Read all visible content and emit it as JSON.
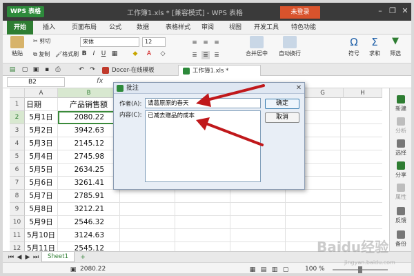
{
  "app": {
    "logo_text": "WPS 表格",
    "doc_title": "工作簿1.xls * [兼容模式] - WPS 表格",
    "login_label": "未登录",
    "window_controls": [
      "min-icon",
      "restore-icon",
      "close-icon"
    ]
  },
  "menu": {
    "tabs": [
      "开始",
      "插入",
      "页面布局",
      "公式",
      "数据",
      "表格样式",
      "审阅",
      "视图",
      "开发工具",
      "特色功能"
    ],
    "active": "开始"
  },
  "ribbon": {
    "paste": "粘贴",
    "cut": "剪切",
    "copy": "复制",
    "format_painter": "格式刷",
    "font_name": "宋体",
    "font_size": "12",
    "merge_center": "合并居中",
    "auto_wrap": "自动换行",
    "symbol": "符号",
    "sum": "求和",
    "filter": "筛选"
  },
  "doc_tabs": [
    {
      "label": "Docer-在线模板",
      "active": false
    },
    {
      "label": "工作簿1.xls *",
      "active": true
    }
  ],
  "formula_bar": {
    "name_box": "B2",
    "fx_label": "fx"
  },
  "sheet": {
    "columns": [
      "A",
      "B",
      "E",
      "F",
      "G",
      "H"
    ],
    "rows": [
      "1",
      "2",
      "3",
      "4",
      "5",
      "6",
      "7",
      "8",
      "9",
      "10",
      "11",
      "12"
    ],
    "header_row": {
      "a": "日期",
      "b": "产品销售额"
    },
    "data": [
      {
        "date": "5月1日",
        "value": "2080.22"
      },
      {
        "date": "5月2日",
        "value": "3942.63"
      },
      {
        "date": "5月3日",
        "value": "2145.12"
      },
      {
        "date": "5月4日",
        "value": "2745.98"
      },
      {
        "date": "5月5日",
        "value": "2634.25"
      },
      {
        "date": "5月6日",
        "value": "3261.41"
      },
      {
        "date": "5月7日",
        "value": "2785.91"
      },
      {
        "date": "5月8日",
        "value": "3212.21"
      },
      {
        "date": "5月9日",
        "value": "2546.32"
      },
      {
        "date": "5月10日",
        "value": "3124.63"
      },
      {
        "date": "5月11日",
        "value": "2545.12"
      }
    ],
    "selected_cell": "B2"
  },
  "sidebar": {
    "items": [
      "新建",
      "分析",
      "选择",
      "分享",
      "属性",
      "反馈",
      "备份"
    ]
  },
  "sheet_tab": "Sheet1",
  "status": {
    "value": "2080.22",
    "zoom": "100 %",
    "zoom_level": 0.5
  },
  "dialog": {
    "title": "批注",
    "author_label": "作者(A):",
    "author_value": "请葛原原的春天",
    "content_label": "内容(C):",
    "content_value": "已减去赠品的成本",
    "ok_label": "确定",
    "cancel_label": "取消"
  },
  "watermark": {
    "text": "Baidu经验",
    "url": "jingyan.baidu.com"
  },
  "colors": {
    "accent": "#2e7d32",
    "annotation_arrow": "#c0181b",
    "login": "#d9532c"
  }
}
